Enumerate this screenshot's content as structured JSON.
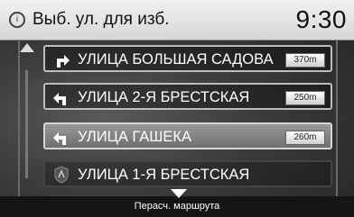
{
  "header": {
    "title": "Выб. ул. для изб.",
    "clock": "9:30",
    "info_icon": "info-icon"
  },
  "streets": [
    {
      "name": "УЛИЦА БОЛЬШАЯ САДОВА",
      "distance": "370m",
      "turn": "right-turn-icon"
    },
    {
      "name": "УЛИЦА 2-Я БРЕСТСКАЯ",
      "distance": "250m",
      "turn": "left-turn-icon"
    },
    {
      "name": "УЛИЦА ГАШЕКА",
      "distance": "260m",
      "turn": "left-turn-icon"
    },
    {
      "name": "УЛИЦА 1-Я БРЕСТСКАЯ",
      "turn": "shield-icon"
    }
  ],
  "footer": {
    "recalc_label": "Перасч. маршрута"
  },
  "colors": {
    "header_bg": "#e6e6e6",
    "item_border": "#bdbdbd",
    "selected_bg": "#8a8a8a"
  }
}
